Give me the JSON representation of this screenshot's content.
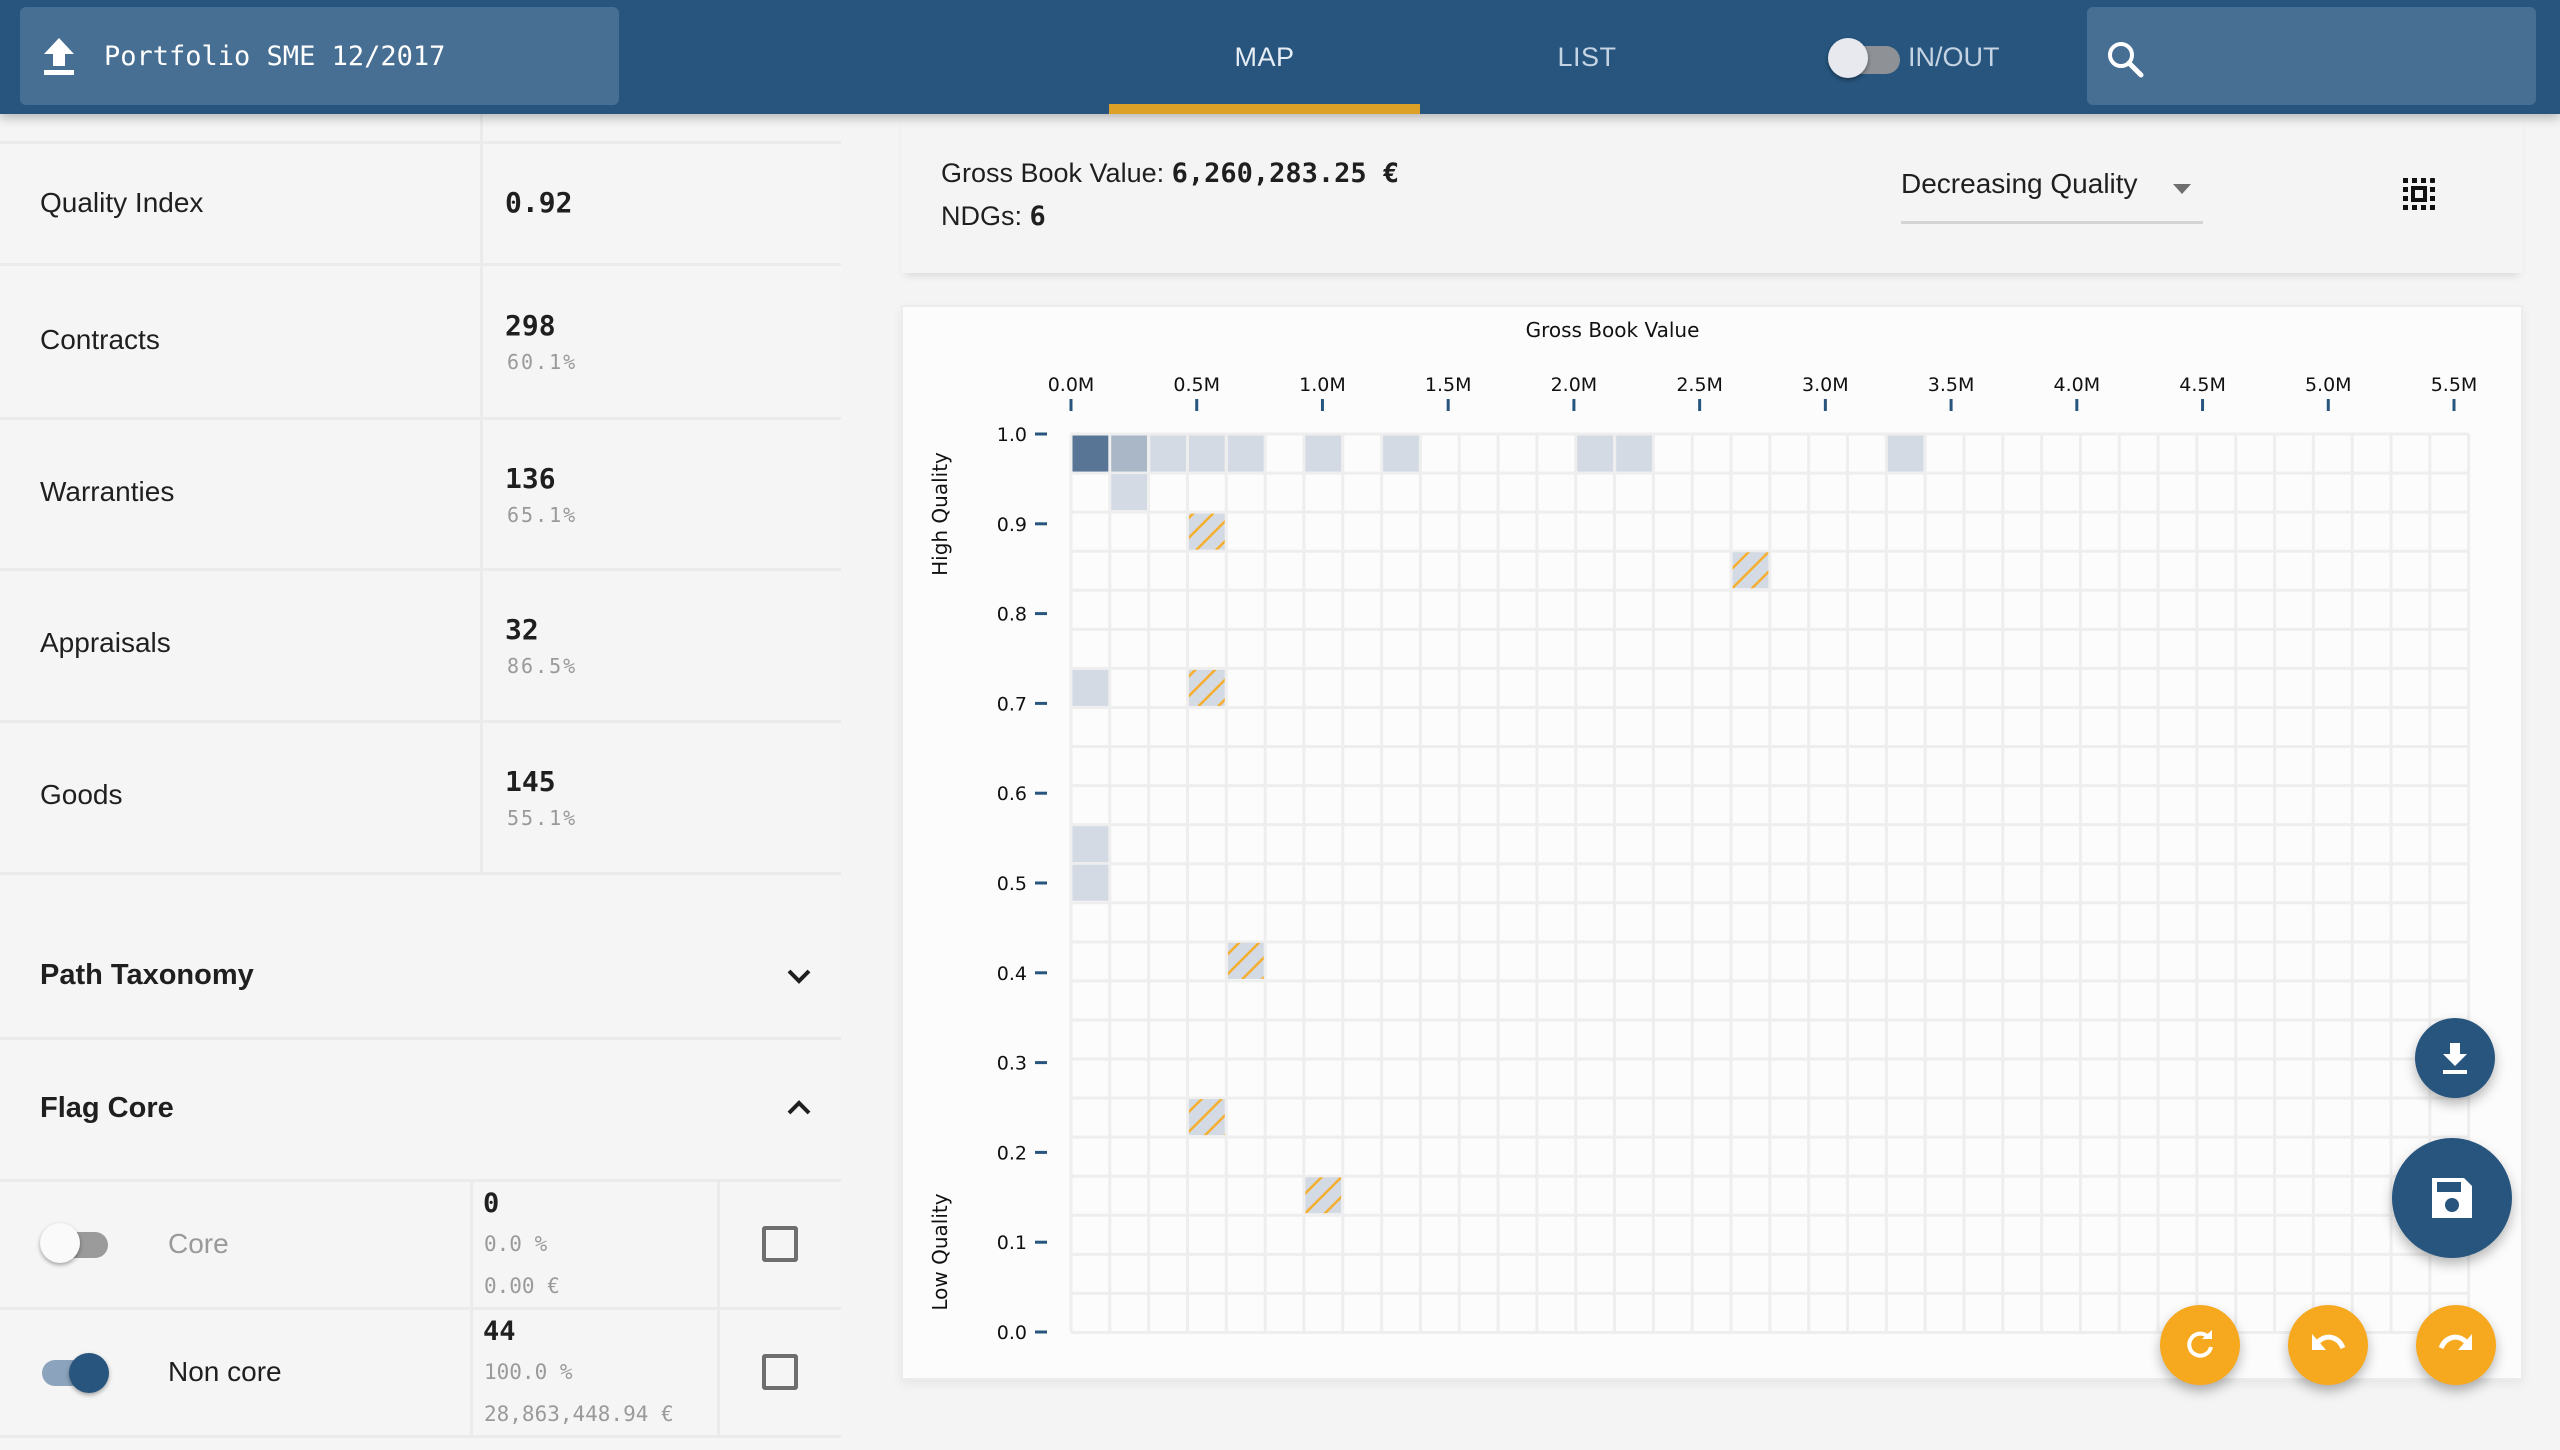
{
  "header": {
    "portfolio_title": "Portfolio SME 12/2017",
    "tabs": [
      {
        "label": "MAP",
        "active": true
      },
      {
        "label": "LIST",
        "active": false
      }
    ],
    "inout_toggle": {
      "label": "IN/OUT",
      "on": false
    },
    "search": {
      "placeholder": "",
      "value": ""
    },
    "colors": {
      "bar": "#27557e",
      "accent": "#dda127"
    }
  },
  "left_panel": {
    "stats": [
      {
        "label": "Quality Index",
        "value": "0.92",
        "pct": ""
      },
      {
        "label": "Contracts",
        "value": "298",
        "pct": "60.1%"
      },
      {
        "label": "Warranties",
        "value": "136",
        "pct": "65.1%"
      },
      {
        "label": "Appraisals",
        "value": "32",
        "pct": "86.5%"
      },
      {
        "label": "Goods",
        "value": "145",
        "pct": "55.1%"
      }
    ],
    "sections": [
      {
        "label": "Path Taxonomy",
        "expanded": false
      },
      {
        "label": "Flag Core",
        "expanded": true
      }
    ],
    "flag_core": [
      {
        "label": "Core",
        "enabled": false,
        "count": "0",
        "pct": "0.0 %",
        "amount": "0.00 €",
        "checked": false
      },
      {
        "label": "Non core",
        "enabled": true,
        "count": "44",
        "pct": "100.0 %",
        "amount": "28,863,448.94 €",
        "checked": false
      }
    ]
  },
  "summary": {
    "gbv_label": "Gross Book Value: ",
    "gbv_value": "6,260,283.25 €",
    "ndg_label": "NDGs: ",
    "ndg_value": "6",
    "sort": {
      "selected": "Decreasing Quality"
    }
  },
  "chart_data": {
    "type": "heatmap",
    "title": "Gross Book Value",
    "xlabel": "Gross Book Value",
    "ylabel_top": "High Quality",
    "ylabel_bottom": "Low Quality",
    "x_unit": "M",
    "xlim": [
      0,
      5.56
    ],
    "ylim": [
      0,
      1.0
    ],
    "x_ticks": [
      "0.0M",
      "0.5M",
      "1.0M",
      "1.5M",
      "2.0M",
      "2.5M",
      "3.0M",
      "3.5M",
      "4.0M",
      "4.5M",
      "5.0M",
      "5.5M"
    ],
    "x_tick_values": [
      0,
      0.5,
      1.0,
      1.5,
      2.0,
      2.5,
      3.0,
      3.5,
      4.0,
      4.5,
      5.0,
      5.5
    ],
    "y_ticks": [
      "1.0",
      "0.9",
      "0.8",
      "0.7",
      "0.6",
      "0.5",
      "0.4",
      "0.3",
      "0.2",
      "0.1",
      "0.0"
    ],
    "y_tick_values": [
      1.0,
      0.9,
      0.8,
      0.7,
      0.6,
      0.5,
      0.4,
      0.3,
      0.2,
      0.1,
      0.0
    ],
    "bin_width": 0.1544,
    "bin_height": 0.0435,
    "n_cols": 36,
    "n_rows": 23,
    "grid": true,
    "legend": {
      "high": {
        "meaning": "dense",
        "color": "#587596"
      },
      "medium": {
        "meaning": "medium",
        "color": "#aab7c7"
      },
      "low": {
        "meaning": "sparse",
        "color": "#d3dae4"
      },
      "selected": {
        "meaning": "selected (hatched)",
        "color": "#d3dae4",
        "stripe": "#f5ae2e"
      }
    },
    "cells": [
      {
        "x0": 0.0,
        "y1": 1.0,
        "level": "high"
      },
      {
        "x0": 0.154,
        "y1": 1.0,
        "level": "medium"
      },
      {
        "x0": 0.309,
        "y1": 1.0,
        "level": "low"
      },
      {
        "x0": 0.463,
        "y1": 1.0,
        "level": "low"
      },
      {
        "x0": 0.618,
        "y1": 1.0,
        "level": "low"
      },
      {
        "x0": 0.926,
        "y1": 1.0,
        "level": "low"
      },
      {
        "x0": 1.235,
        "y1": 1.0,
        "level": "low"
      },
      {
        "x0": 2.007,
        "y1": 1.0,
        "level": "low"
      },
      {
        "x0": 2.162,
        "y1": 1.0,
        "level": "low"
      },
      {
        "x0": 3.242,
        "y1": 1.0,
        "level": "low"
      },
      {
        "x0": 0.154,
        "y1": 0.957,
        "level": "low"
      },
      {
        "x0": 0.463,
        "y1": 0.913,
        "level": "selected"
      },
      {
        "x0": 2.625,
        "y1": 0.87,
        "level": "selected"
      },
      {
        "x0": 0.0,
        "y1": 0.739,
        "level": "low"
      },
      {
        "x0": 0.463,
        "y1": 0.739,
        "level": "selected"
      },
      {
        "x0": 0.0,
        "y1": 0.565,
        "level": "low"
      },
      {
        "x0": 0.0,
        "y1": 0.522,
        "level": "low"
      },
      {
        "x0": 0.618,
        "y1": 0.435,
        "level": "selected"
      },
      {
        "x0": 0.463,
        "y1": 0.261,
        "level": "selected"
      },
      {
        "x0": 0.926,
        "y1": 0.174,
        "level": "selected"
      }
    ]
  },
  "fabs": {
    "download": "download-icon",
    "save": "save-icon",
    "refresh": "refresh-icon",
    "undo": "undo-icon",
    "redo": "redo-icon"
  }
}
